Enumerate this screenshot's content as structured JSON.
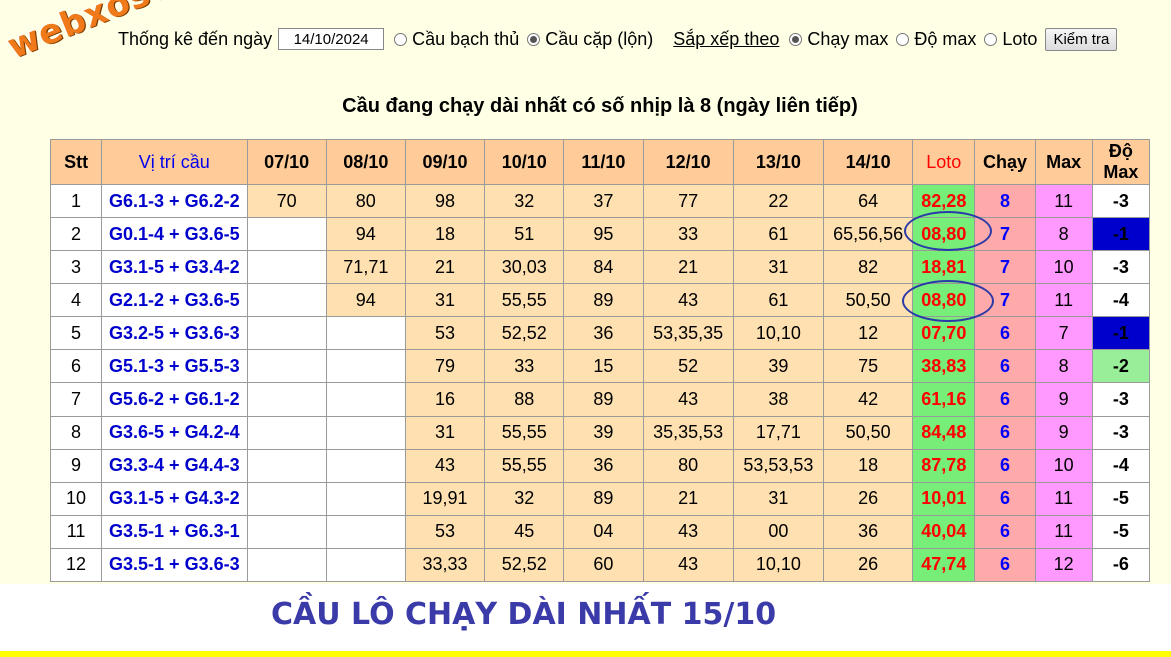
{
  "brand": {
    "logo_text": "webxoso.net"
  },
  "controls": {
    "stat_label": "Thống kê đến ngày",
    "date_value": "14/10/2024",
    "radio_bach_thu": "Cầu bạch thủ",
    "radio_cap": "Cầu cặp (lộn)",
    "sort_label": "Sắp xếp theo",
    "radio_chay_max": "Chạy max",
    "radio_do_max": "Độ max",
    "radio_loto": "Loto",
    "check_button": "Kiểm tra",
    "selected_type": "Cầu cặp (lộn)",
    "selected_sort": "Chạy max"
  },
  "heading": "Cầu đang chạy dài nhất có số nhịp là 8 (ngày liên tiếp)",
  "table": {
    "headers": {
      "stt": "Stt",
      "position": "Vị trí cầu",
      "dates": [
        "07/10",
        "08/10",
        "09/10",
        "10/10",
        "11/10",
        "12/10",
        "13/10",
        "14/10"
      ],
      "loto": "Loto",
      "chay": "Chạy",
      "max": "Max",
      "do_max_1": "Độ",
      "do_max_2": "Max"
    },
    "rows": [
      {
        "stt": "1",
        "pos": "G6.1-3 + G6.2-2",
        "d": [
          "70",
          "80",
          "98",
          "32",
          "37",
          "77",
          "22",
          "64"
        ],
        "loto": "82,28",
        "chay": "8",
        "max": "11",
        "domax": "-3",
        "domax_style": ""
      },
      {
        "stt": "2",
        "pos": "G0.1-4 + G3.6-5",
        "d": [
          "",
          "94",
          "18",
          "51",
          "95",
          "33",
          "61",
          "65,56,56"
        ],
        "loto": "08,80",
        "chay": "7",
        "max": "8",
        "domax": "-1",
        "domax_style": "blue"
      },
      {
        "stt": "3",
        "pos": "G3.1-5 + G3.4-2",
        "d": [
          "",
          "71,71",
          "21",
          "30,03",
          "84",
          "21",
          "31",
          "82"
        ],
        "loto": "18,81",
        "chay": "7",
        "max": "10",
        "domax": "-3",
        "domax_style": ""
      },
      {
        "stt": "4",
        "pos": "G2.1-2 + G3.6-5",
        "d": [
          "",
          "94",
          "31",
          "55,55",
          "89",
          "43",
          "61",
          "50,50"
        ],
        "loto": "08,80",
        "chay": "7",
        "max": "11",
        "domax": "-4",
        "domax_style": ""
      },
      {
        "stt": "5",
        "pos": "G3.2-5 + G3.6-3",
        "d": [
          "",
          "",
          "53",
          "52,52",
          "36",
          "53,35,35",
          "10,10",
          "12"
        ],
        "loto": "07,70",
        "chay": "6",
        "max": "7",
        "domax": "-1",
        "domax_style": "blue"
      },
      {
        "stt": "6",
        "pos": "G5.1-3 + G5.5-3",
        "d": [
          "",
          "",
          "79",
          "33",
          "15",
          "52",
          "39",
          "75"
        ],
        "loto": "38,83",
        "chay": "6",
        "max": "8",
        "domax": "-2",
        "domax_style": "green"
      },
      {
        "stt": "7",
        "pos": "G5.6-2 + G6.1-2",
        "d": [
          "",
          "",
          "16",
          "88",
          "89",
          "43",
          "38",
          "42"
        ],
        "loto": "61,16",
        "chay": "6",
        "max": "9",
        "domax": "-3",
        "domax_style": ""
      },
      {
        "stt": "8",
        "pos": "G3.6-5 + G4.2-4",
        "d": [
          "",
          "",
          "31",
          "55,55",
          "39",
          "35,35,53",
          "17,71",
          "50,50"
        ],
        "loto": "84,48",
        "chay": "6",
        "max": "9",
        "domax": "-3",
        "domax_style": ""
      },
      {
        "stt": "9",
        "pos": "G3.3-4 + G4.4-3",
        "d": [
          "",
          "",
          "43",
          "55,55",
          "36",
          "80",
          "53,53,53",
          "18"
        ],
        "loto": "87,78",
        "chay": "6",
        "max": "10",
        "domax": "-4",
        "domax_style": ""
      },
      {
        "stt": "10",
        "pos": "G3.1-5 + G4.3-2",
        "d": [
          "",
          "",
          "19,91",
          "32",
          "89",
          "21",
          "31",
          "26"
        ],
        "loto": "10,01",
        "chay": "6",
        "max": "11",
        "domax": "-5",
        "domax_style": ""
      },
      {
        "stt": "11",
        "pos": "G3.5-1 + G6.3-1",
        "d": [
          "",
          "",
          "53",
          "45",
          "04",
          "43",
          "00",
          "36"
        ],
        "loto": "40,04",
        "chay": "6",
        "max": "11",
        "domax": "-5",
        "domax_style": ""
      },
      {
        "stt": "12",
        "pos": "G3.5-1 + G3.6-3",
        "d": [
          "",
          "",
          "33,33",
          "52,52",
          "60",
          "43",
          "10,10",
          "26"
        ],
        "loto": "47,74",
        "chay": "6",
        "max": "12",
        "domax": "-6",
        "domax_style": ""
      }
    ]
  },
  "footer_title": "CẦU LÔ CHẠY DÀI NHẤT 15/10",
  "colors": {
    "page_bg": "#ffffe6",
    "header_bg": "#ffcc99",
    "cell_bg": "#ffe0b0",
    "loto_bg": "#77ee77",
    "chay_bg": "#ffaaaa",
    "max_bg": "#ff99ff",
    "domax_blue": "#0000cc",
    "domax_green": "#99ee99",
    "footer_text": "#3a3aa8",
    "circle_annotation": "#2a3aa8"
  }
}
